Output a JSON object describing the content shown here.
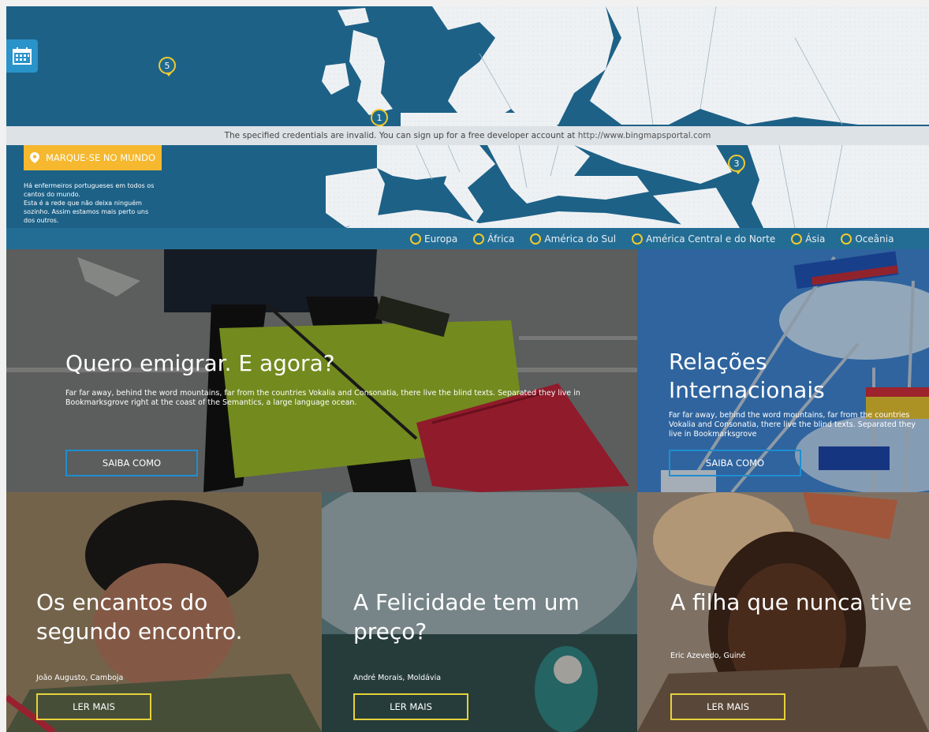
{
  "map": {
    "markers": [
      {
        "label": "5"
      },
      {
        "label": "1"
      },
      {
        "label": "3"
      }
    ],
    "credentials_text": "The specified credentials are invalid. You can sign up for a free developer account at",
    "credentials_link": "http://www.bingmapsportal.com",
    "mark_button_label": "MARQUE-SE NO MUNDO",
    "description_lines": [
      "Há enfermeiros portugueses em todos os",
      "cantos do mundo.",
      "Esta é a rede que não deixa ninguém",
      "sozinho. Assim estamos mais perto uns",
      "dos outros."
    ],
    "legend": [
      "Europa",
      "África",
      "América do Sul",
      "América Central e do Norte",
      "Ásia",
      "Oceânia"
    ],
    "colors": {
      "ocean": "#1d6187",
      "land": "#eef1f3",
      "accent": "#f5b82e",
      "marker_ring": "#f0c92c"
    }
  },
  "hero_left": {
    "title": "Quero emigrar. E agora?",
    "text": "Far far away, behind the word mountains, far from the countries Vokalia and Consonatia, there live the blind texts. Separated they live in Bookmarksgrove right at the coast of the Semantics, a large language ocean.",
    "button": "SAIBA COMO"
  },
  "hero_right": {
    "title_line1": "Relações",
    "title_line2": "Internacionais",
    "text": "Far far away, behind the word mountains, far from the countries Vokalia and Consonatia, there live the blind texts. Separated they live in Bookmarksgrove",
    "button": "SAIBA COMO"
  },
  "stories": [
    {
      "title_line1": "Os encantos do",
      "title_line2": "segundo encontro.",
      "author": "João Augusto, Camboja",
      "button": "LER MAIS"
    },
    {
      "title_line1": "A Felicidade tem um",
      "title_line2": "preço?",
      "author": "André Morais, Moldávia",
      "button": "LER MAIS"
    },
    {
      "title_line1": "A filha que nunca tive",
      "title_line2": "",
      "author": "Eric Azevedo, Guiné",
      "button": "LER MAIS"
    }
  ]
}
